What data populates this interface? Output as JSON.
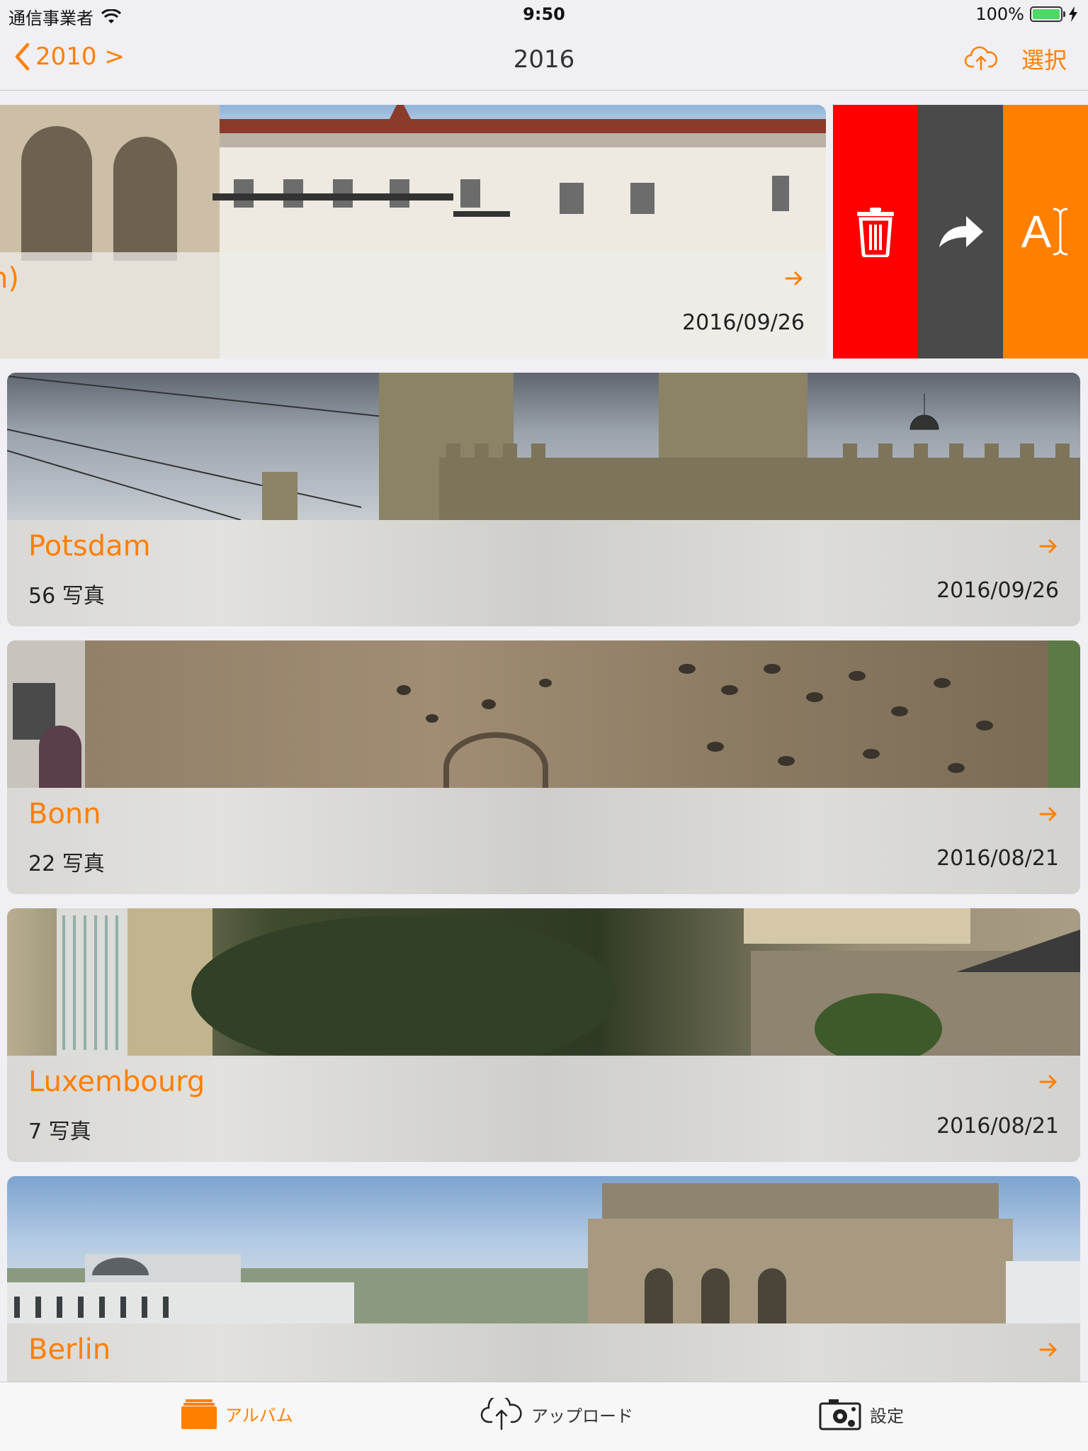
{
  "status_bar": {
    "carrier": "通信事業者",
    "time": "9:50",
    "battery": "100%",
    "battery_level": 1.0
  },
  "nav": {
    "back_label": "2010 >",
    "title": "2016",
    "select_label": "選択",
    "upload_icon": "cloud-upload-icon"
  },
  "albums": [
    {
      "name": "n)",
      "count": "",
      "date": "2016/09/26",
      "swiped": true
    },
    {
      "name": "Potsdam",
      "count": "56 写真",
      "date": "2016/09/26"
    },
    {
      "name": "Bonn",
      "count": "22 写真",
      "date": "2016/08/21"
    },
    {
      "name": "Luxembourg",
      "count": "7 写真",
      "date": "2016/08/21"
    },
    {
      "name": "Berlin",
      "count": "",
      "date": ""
    }
  ],
  "swipe_actions": [
    {
      "label": "delete",
      "icon": "trash-icon",
      "color": "#ff0000"
    },
    {
      "label": "share",
      "icon": "share-arrow-icon",
      "color": "#4a4a4a"
    },
    {
      "label": "rename",
      "icon": "rename-text-icon",
      "color": "#ff7f00",
      "glyph": "A"
    }
  ],
  "tabs": [
    {
      "label": "アルバム",
      "icon": "album-icon",
      "selected": true
    },
    {
      "label": "アップロード",
      "icon": "cloud-upload-icon",
      "selected": false
    },
    {
      "label": "設定",
      "icon": "camera-settings-icon",
      "selected": false
    }
  ],
  "colors": {
    "accent": "#ff7f00",
    "delete": "#ff0000",
    "share": "#4a4a4a",
    "background": "#efeff4"
  }
}
